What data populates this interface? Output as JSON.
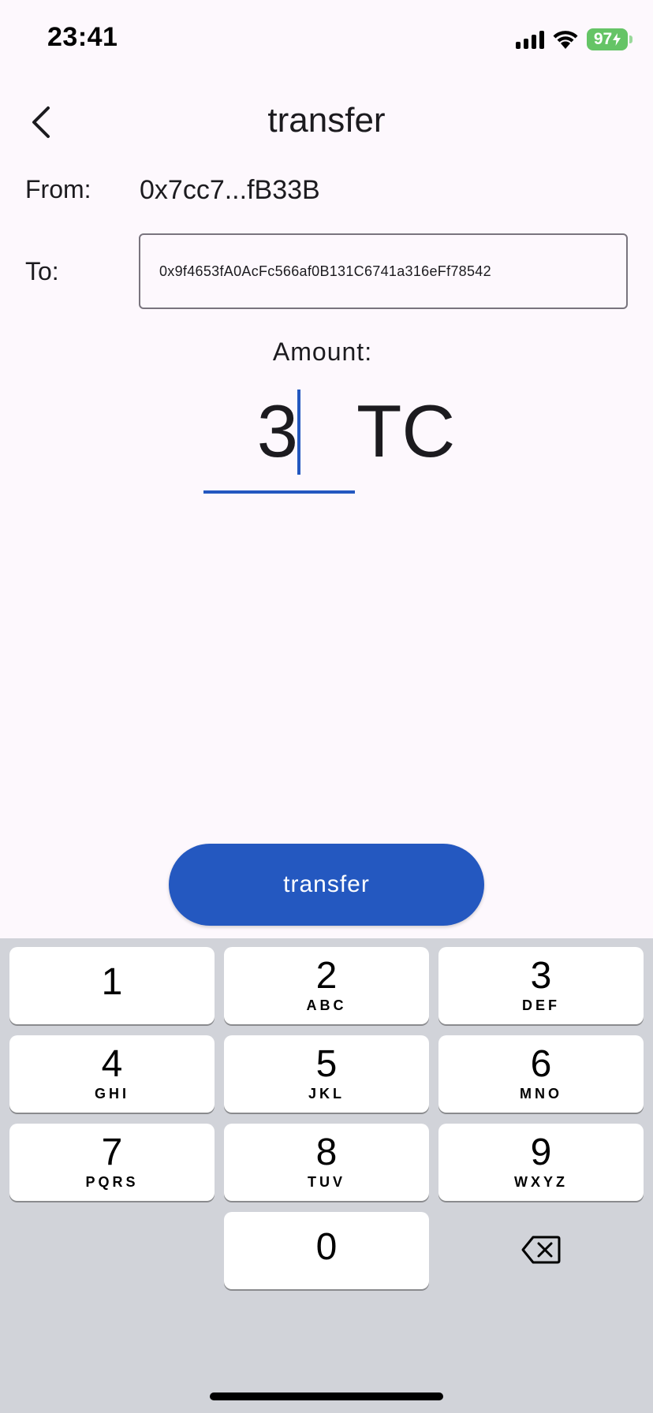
{
  "status_bar": {
    "time": "23:41",
    "battery": "97"
  },
  "header": {
    "title": "transfer",
    "back_icon": "chevron-left-icon"
  },
  "form": {
    "from_label": "From:",
    "from_value": "0x7cc7...fB33B",
    "to_label": "To:",
    "to_value": "0x9f4653fA0AcFc566af0B131C6741a316eFf78542",
    "amount_label": "Amount:",
    "amount_value": "3",
    "amount_unit": "TC"
  },
  "action": {
    "transfer_label": "transfer"
  },
  "keypad": {
    "keys": [
      {
        "digit": "1",
        "letters": ""
      },
      {
        "digit": "2",
        "letters": "ABC"
      },
      {
        "digit": "3",
        "letters": "DEF"
      },
      {
        "digit": "4",
        "letters": "GHI"
      },
      {
        "digit": "5",
        "letters": "JKL"
      },
      {
        "digit": "6",
        "letters": "MNO"
      },
      {
        "digit": "7",
        "letters": "PQRS"
      },
      {
        "digit": "8",
        "letters": "TUV"
      },
      {
        "digit": "9",
        "letters": "WXYZ"
      },
      {
        "digit": "0",
        "letters": ""
      }
    ],
    "delete_icon": "backspace-icon"
  },
  "colors": {
    "accent": "#2458c0",
    "background": "#fdf8fd",
    "keyboard_bg": "#d1d3d9",
    "battery": "#65c466"
  }
}
